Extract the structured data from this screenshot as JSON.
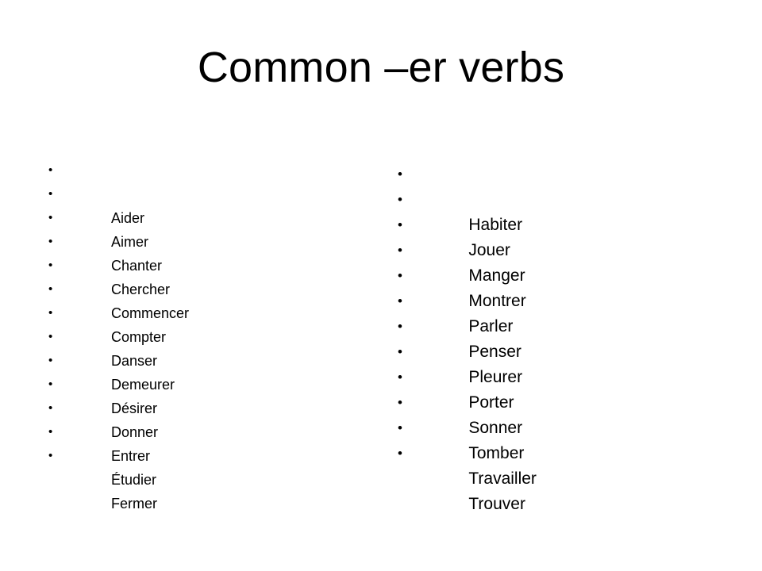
{
  "slide": {
    "title": "Common –er verbs",
    "background_color": "#ffffff",
    "text_color": "#000000",
    "bullet_glyph": "•",
    "columns": [
      {
        "name": "left-column",
        "items": [
          "Aider",
          "Aimer",
          "Chanter",
          "Chercher",
          "Commencer",
          "Compter",
          "Danser",
          "Demeurer",
          "Désirer",
          "Donner",
          "Entrer",
          "Étudier",
          "Fermer"
        ]
      },
      {
        "name": "right-column",
        "items": [
          "Habiter",
          "Jouer",
          "Manger",
          "Montrer",
          "Parler",
          "Penser",
          "Pleurer",
          "Porter",
          "Sonner",
          "Tomber",
          "Travailler",
          "Trouver"
        ]
      }
    ]
  }
}
